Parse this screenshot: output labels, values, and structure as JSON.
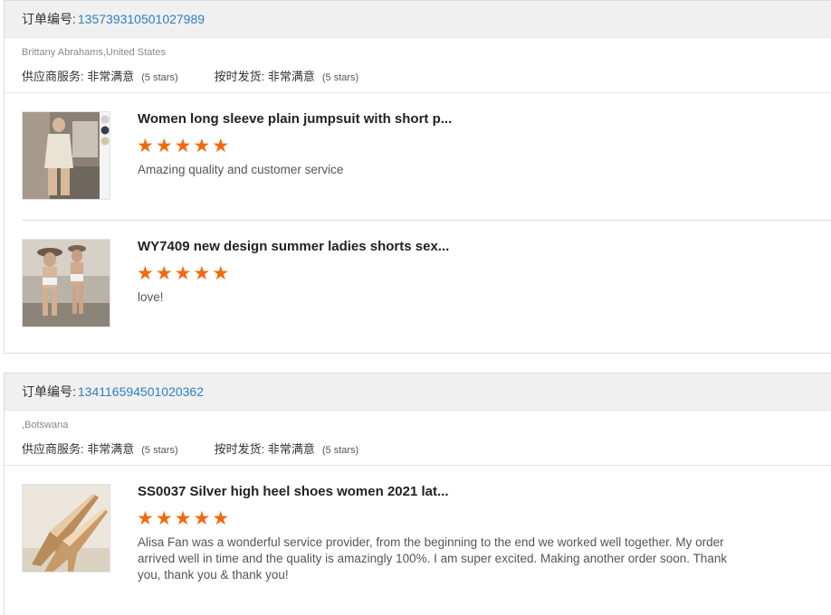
{
  "labels": {
    "order_no": "订单编号:",
    "supplier_service": "供应商服务:",
    "on_time_shipping": "按时发货:"
  },
  "colors": {
    "star": "#f26a10",
    "order_link": "#2e7fc2"
  },
  "orders": [
    {
      "order_number": "135739310501027989",
      "buyer": "Brittany Abrahams,United States",
      "supplier_rating": "非常满意",
      "supplier_stars": "(5 stars)",
      "shipping_rating": "非常满意",
      "shipping_stars": "(5 stars)",
      "items": [
        {
          "title": "Women long sleeve plain jumpsuit with short p...",
          "stars": 5,
          "comment": "Amazing quality and customer service",
          "image": "jumpsuit-photo"
        },
        {
          "title": "WY7409 new design summer ladies shorts sex...",
          "stars": 5,
          "comment": "love!",
          "image": "shorts-photo"
        }
      ]
    },
    {
      "order_number": "134116594501020362",
      "buyer": ",Botswana",
      "supplier_rating": "非常满意",
      "supplier_stars": "(5 stars)",
      "shipping_rating": "非常满意",
      "shipping_stars": "(5 stars)",
      "items": [
        {
          "title": "SS0037 Silver high heel shoes women 2021 lat...",
          "stars": 5,
          "comment": "Alisa Fan was a wonderful service provider, from the beginning to the end we worked well together. My order arrived well in time and the quality is amazingly 100%. I am super excited. Making another order soon. Thank you, thank you & thank you!",
          "image": "heels-photo"
        }
      ]
    }
  ]
}
